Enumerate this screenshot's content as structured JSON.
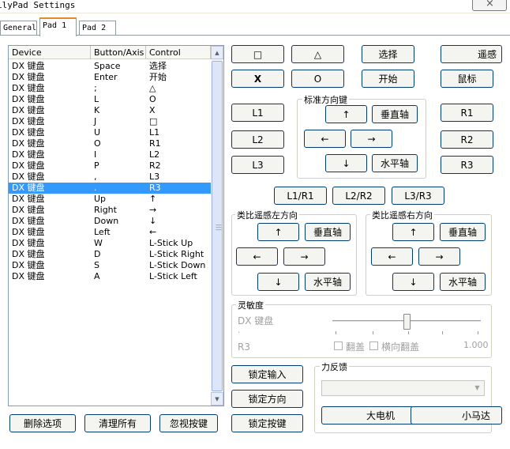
{
  "window": {
    "title": "ilyPad Settings"
  },
  "tabs": [
    {
      "label": "General"
    },
    {
      "label": "Pad 1"
    },
    {
      "label": "Pad 2"
    }
  ],
  "list": {
    "headers": [
      "Device",
      "Button/Axis",
      "Control"
    ],
    "selected_index": 11,
    "rows": [
      {
        "device": "DX 键盘",
        "button": "Space",
        "control": "选择"
      },
      {
        "device": "DX 键盘",
        "button": "Enter",
        "control": "开始"
      },
      {
        "device": "DX 键盘",
        "button": ";",
        "control": "△"
      },
      {
        "device": "DX 键盘",
        "button": "L",
        "control": "O"
      },
      {
        "device": "DX 键盘",
        "button": "K",
        "control": "X"
      },
      {
        "device": "DX 键盘",
        "button": "J",
        "control": "□"
      },
      {
        "device": "DX 键盘",
        "button": "U",
        "control": "L1"
      },
      {
        "device": "DX 键盘",
        "button": "O",
        "control": "R1"
      },
      {
        "device": "DX 键盘",
        "button": "I",
        "control": "L2"
      },
      {
        "device": "DX 键盘",
        "button": "P",
        "control": "R2"
      },
      {
        "device": "DX 键盘",
        "button": ",",
        "control": "L3"
      },
      {
        "device": "DX 键盘",
        "button": ".",
        "control": "R3"
      },
      {
        "device": "DX 键盘",
        "button": "Up",
        "control": "↑"
      },
      {
        "device": "DX 键盘",
        "button": "Right",
        "control": "→"
      },
      {
        "device": "DX 键盘",
        "button": "Down",
        "control": "↓"
      },
      {
        "device": "DX 键盘",
        "button": "Left",
        "control": "←"
      },
      {
        "device": "DX 键盘",
        "button": "W",
        "control": "L-Stick Up"
      },
      {
        "device": "DX 键盘",
        "button": "D",
        "control": "L-Stick Right"
      },
      {
        "device": "DX 键盘",
        "button": "S",
        "control": "L-Stick Down"
      },
      {
        "device": "DX 键盘",
        "button": "A",
        "control": "L-Stick Left"
      }
    ]
  },
  "bottom_buttons": {
    "delete": "删除选项",
    "clear": "清理所有",
    "ignore": "忽视按键"
  },
  "face_buttons": {
    "square": "□",
    "triangle": "△",
    "select": "选择",
    "remote": "遥感",
    "cross": "X",
    "circle": "O",
    "start": "开始",
    "mouse": "鼠标"
  },
  "shoulders": {
    "l1": "L1",
    "l2": "L2",
    "l3": "L3",
    "r1": "R1",
    "r2": "R2",
    "r3": "R3"
  },
  "dpad": {
    "label": "标准方向键",
    "up": "↑",
    "left": "←",
    "right": "→",
    "down": "↓",
    "vertical": "垂直轴",
    "horizontal": "水平轴"
  },
  "pairs": {
    "lr1": "L1/R1",
    "lr2": "L2/R2",
    "lr3": "L3/R3"
  },
  "left_stick": {
    "label": "类比遥感左方向",
    "up": "↑",
    "left": "←",
    "right": "→",
    "down": "↓",
    "vertical": "垂直轴",
    "horizontal": "水平轴"
  },
  "right_stick": {
    "label": "类比遥感右方向",
    "up": "↑",
    "left": "←",
    "right": "→",
    "down": "↓",
    "vertical": "垂直轴",
    "horizontal": "水平轴"
  },
  "sensitivity": {
    "label": "灵敏度",
    "device": "DX 键盘",
    "dot": ".",
    "control": "R3",
    "flip": "翻盖",
    "horizontal_flip": "横向翻盖",
    "value": "1.000",
    "slider_fraction": 0.5
  },
  "lock_buttons": {
    "input": "锁定输入",
    "direction": "锁定方向",
    "keys": "锁定按键"
  },
  "force_feedback": {
    "label": "力反馈",
    "big_motor": "大电机",
    "small_motor": "小马达"
  },
  "colors": {
    "selection": "#3399ff",
    "tab_accent": "#e68b2c",
    "button_border": "#003c74"
  },
  "icons": {
    "close": "close-icon",
    "scroll_up": "up-triangle-icon",
    "scroll_down": "down-triangle-icon",
    "combo": "chevron-down-icon"
  }
}
